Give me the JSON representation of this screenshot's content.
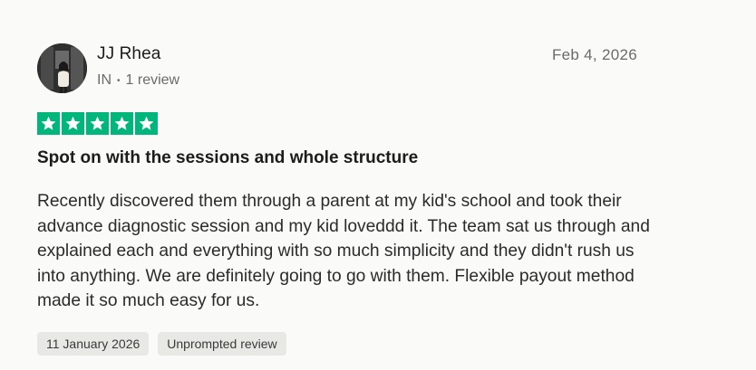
{
  "reviewer": {
    "name": "JJ Rhea",
    "country": "IN",
    "review_count": "1 review",
    "separator": "•"
  },
  "review": {
    "date": "Feb 4, 2026",
    "rating": 5,
    "max_rating": 5,
    "title": "Spot on with the sessions and whole structure",
    "body": "Recently discovered them through a parent at my kid's school and took their advance diagnostic session and my kid loveddd it. The team sat us through and explained each and everything with so much simplicity and they didn't rush us into anything. We are definitely going to go with them. Flexible payout method made it so much easy for us."
  },
  "tags": {
    "experience_date": "11 January 2026",
    "review_type": "Unprompted review"
  },
  "colors": {
    "star_green": "#00b67a",
    "background": "#fafaf8",
    "tag_bg": "#e8e8e4"
  },
  "icons": {
    "star": "star-icon",
    "avatar": "avatar-photo"
  }
}
